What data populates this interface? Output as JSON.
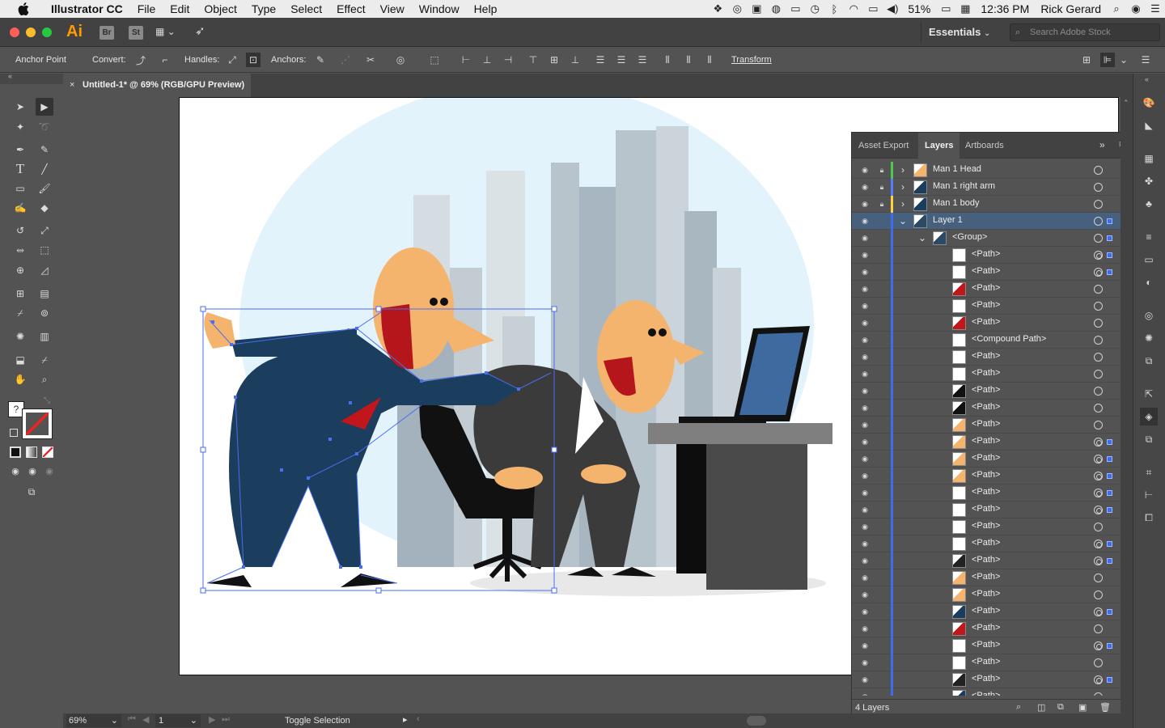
{
  "menubar": {
    "app_name": "Illustrator CC",
    "menus": [
      "File",
      "Edit",
      "Object",
      "Type",
      "Select",
      "Effect",
      "View",
      "Window",
      "Help"
    ],
    "battery": "51%",
    "time": "12:36 PM",
    "user": "Rick Gerard"
  },
  "appbar": {
    "logo": "Ai",
    "bridge": "Br",
    "stock_btn": "St",
    "workspace": "Essentials",
    "stock_search_placeholder": "Search Adobe Stock"
  },
  "control": {
    "mode": "Anchor Point",
    "convert": "Convert:",
    "handles": "Handles:",
    "anchors": "Anchors:",
    "transform": "Transform"
  },
  "document": {
    "tab_title": "Untitled-1* @ 69% (RGB/GPU Preview)"
  },
  "status": {
    "zoom": "69%",
    "artboard_num": "1",
    "tool_status": "Toggle Selection"
  },
  "layers_panel": {
    "tabs": [
      "Asset Export",
      "Layers",
      "Artboards"
    ],
    "active_tab": "Layers",
    "footer": "4 Layers",
    "rows": [
      {
        "name": "Man 1 Head",
        "level": 0,
        "locked": true,
        "color": "#4cc94c",
        "expanded": false,
        "target": "empty",
        "selected": false,
        "thumb": "head"
      },
      {
        "name": "Man 1 right arm",
        "level": 0,
        "locked": true,
        "color": "#5b7bff",
        "expanded": false,
        "target": "empty",
        "selected": false,
        "thumb": "arm"
      },
      {
        "name": "Man 1 body",
        "level": 0,
        "locked": true,
        "color": "#ffd23d",
        "expanded": false,
        "target": "empty",
        "selected": false,
        "thumb": "body"
      },
      {
        "name": "Layer 1",
        "level": 0,
        "locked": false,
        "color": "#3d6cf0",
        "expanded": true,
        "target": "empty",
        "selected": true,
        "rowsel": true,
        "thumb": "scene"
      },
      {
        "name": "<Group>",
        "level": 1,
        "locked": false,
        "color": "#3d6cf0",
        "expanded": true,
        "target": "empty",
        "selected": true,
        "thumb": "scene"
      },
      {
        "name": "<Path>",
        "level": 2,
        "color": "#3d6cf0",
        "target": "fill",
        "selected": true,
        "thumb": "shoe"
      },
      {
        "name": "<Path>",
        "level": 2,
        "color": "#3d6cf0",
        "target": "fill",
        "selected": true,
        "thumb": "shoe"
      },
      {
        "name": "<Path>",
        "level": 2,
        "color": "#3d6cf0",
        "target": "empty",
        "selected": false,
        "thumb": "red"
      },
      {
        "name": "<Path>",
        "level": 2,
        "color": "#3d6cf0",
        "target": "empty",
        "selected": false,
        "thumb": "blank"
      },
      {
        "name": "<Path>",
        "level": 2,
        "color": "#3d6cf0",
        "target": "empty",
        "selected": false,
        "thumb": "red"
      },
      {
        "name": "<Compound Path>",
        "level": 2,
        "color": "#3d6cf0",
        "target": "empty",
        "selected": false,
        "thumb": "lines"
      },
      {
        "name": "<Path>",
        "level": 2,
        "color": "#3d6cf0",
        "target": "empty",
        "selected": false,
        "thumb": "arc"
      },
      {
        "name": "<Path>",
        "level": 2,
        "color": "#3d6cf0",
        "target": "empty",
        "selected": false,
        "thumb": "arc"
      },
      {
        "name": "<Path>",
        "level": 2,
        "color": "#3d6cf0",
        "target": "empty",
        "selected": false,
        "thumb": "eye"
      },
      {
        "name": "<Path>",
        "level": 2,
        "color": "#3d6cf0",
        "target": "empty",
        "selected": false,
        "thumb": "eye"
      },
      {
        "name": "<Path>",
        "level": 2,
        "color": "#3d6cf0",
        "target": "empty",
        "selected": false,
        "thumb": "skin"
      },
      {
        "name": "<Path>",
        "level": 2,
        "color": "#3d6cf0",
        "target": "fill",
        "selected": true,
        "thumb": "skin"
      },
      {
        "name": "<Path>",
        "level": 2,
        "color": "#3d6cf0",
        "target": "fill",
        "selected": true,
        "thumb": "skin"
      },
      {
        "name": "<Path>",
        "level": 2,
        "color": "#3d6cf0",
        "target": "fill",
        "selected": true,
        "thumb": "skin"
      },
      {
        "name": "<Path>",
        "level": 2,
        "color": "#3d6cf0",
        "target": "fill",
        "selected": true,
        "thumb": "line"
      },
      {
        "name": "<Path>",
        "level": 2,
        "color": "#3d6cf0",
        "target": "fill",
        "selected": true,
        "thumb": "line"
      },
      {
        "name": "<Path>",
        "level": 2,
        "color": "#3d6cf0",
        "target": "empty",
        "selected": false,
        "thumb": "line"
      },
      {
        "name": "<Path>",
        "level": 2,
        "color": "#3d6cf0",
        "target": "fill",
        "selected": true,
        "thumb": "shoe"
      },
      {
        "name": "<Path>",
        "level": 2,
        "color": "#3d6cf0",
        "target": "fill",
        "selected": true,
        "thumb": "dark"
      },
      {
        "name": "<Path>",
        "level": 2,
        "color": "#3d6cf0",
        "target": "empty",
        "selected": false,
        "thumb": "skin"
      },
      {
        "name": "<Path>",
        "level": 2,
        "color": "#3d6cf0",
        "target": "empty",
        "selected": false,
        "thumb": "skin"
      },
      {
        "name": "<Path>",
        "level": 2,
        "color": "#3d6cf0",
        "target": "fill",
        "selected": true,
        "thumb": "navy"
      },
      {
        "name": "<Path>",
        "level": 2,
        "color": "#3d6cf0",
        "target": "empty",
        "selected": false,
        "thumb": "red"
      },
      {
        "name": "<Path>",
        "level": 2,
        "color": "#3d6cf0",
        "target": "fill",
        "selected": true,
        "thumb": "blank"
      },
      {
        "name": "<Path>",
        "level": 2,
        "color": "#3d6cf0",
        "target": "empty",
        "selected": false,
        "thumb": "line"
      },
      {
        "name": "<Path>",
        "level": 2,
        "color": "#3d6cf0",
        "target": "fill",
        "selected": true,
        "thumb": "dark"
      },
      {
        "name": "<Path>",
        "level": 2,
        "color": "#3d6cf0",
        "target": "empty",
        "selected": false,
        "thumb": "navy"
      }
    ]
  },
  "colors": {
    "accent": "#ff9a00",
    "selection": "#3d6cf0",
    "panel": "#535353"
  }
}
